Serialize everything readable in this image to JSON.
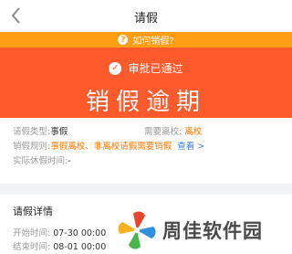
{
  "nav": {
    "title": "请假"
  },
  "help": {
    "label": "如何销假?"
  },
  "hero": {
    "status": "审批已通过",
    "title": "销假逾期"
  },
  "info": {
    "type_label": "请假类型:",
    "type_value": "事假",
    "leave_school_label": "需要离校:",
    "leave_school_value": "离校",
    "rule_label": "销假规则:",
    "rule_value": "事假离校、非离校请假需要销假",
    "rule_link": "查看 >",
    "actual_label": "实际休假时间:",
    "actual_value": "-"
  },
  "detail": {
    "title": "请假详情",
    "start_label": "开始时间:",
    "start_value": "07-30 00:00",
    "end_label": "结束时间:",
    "end_value": "08-01 00:00"
  },
  "watermark": {
    "text": "周佳软件园"
  },
  "colors": {
    "accent": "#ff5a2b",
    "help_bar": "#ff9d14",
    "link": "#3b7ddd"
  }
}
